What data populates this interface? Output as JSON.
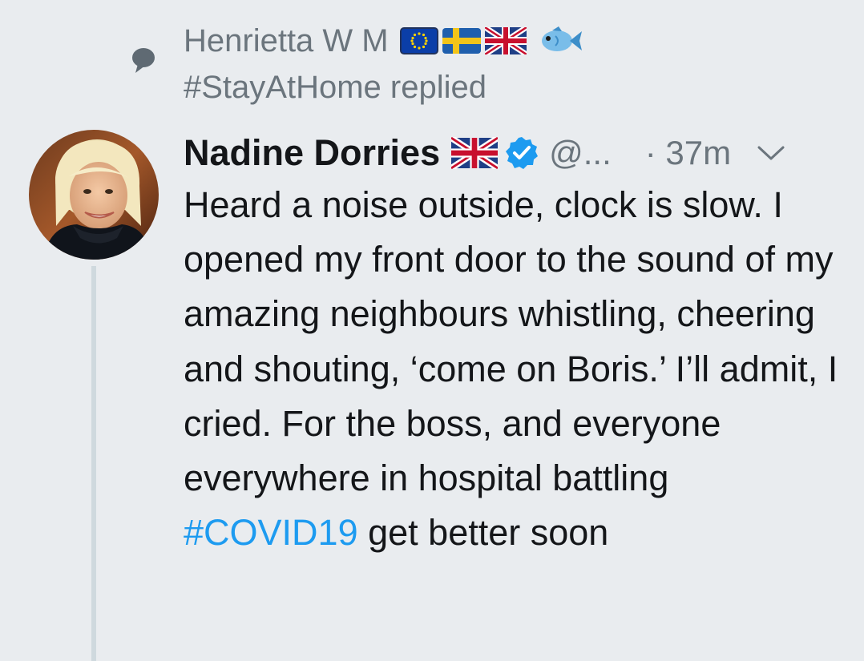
{
  "context": {
    "user_name": "Henrietta W M",
    "flag_icons": [
      "eu-flag-icon",
      "sweden-flag-icon",
      "uk-flag-icon"
    ],
    "emoji_icon": "fish-icon",
    "hashtag": "#StayAtHome",
    "action": "replied"
  },
  "tweet": {
    "author_name": "Nadine Dorries",
    "author_flag_icon": "uk-flag-icon",
    "verified_icon": "verified-badge-icon",
    "handle": "@...",
    "time": "· 37m",
    "body_text": "Heard a noise outside, clock is slow. I opened my front door to the sound of my amazing neighbours whistling, cheering and shouting, ‘come on Boris.’ I’ll admit, I cried. For the boss, and everyone everywhere in hospital battling ",
    "hashtag": "#COVID19",
    "body_end": " get better soon"
  },
  "colors": {
    "background": "#e9ecef",
    "text": "#141619",
    "muted": "#6b757d",
    "link": "#1d9bf0",
    "thread_line": "#cfd9de"
  }
}
